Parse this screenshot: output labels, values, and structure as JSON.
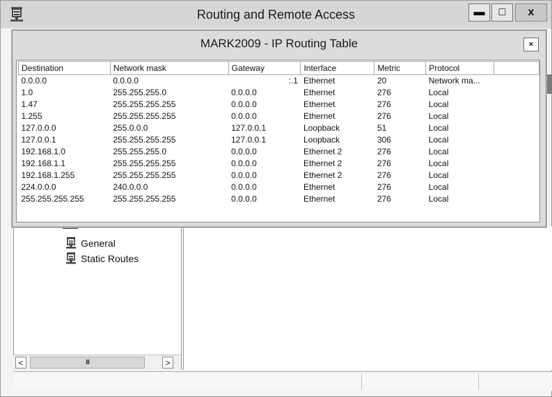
{
  "window": {
    "title": "Routing and Remote Access",
    "buttons": {
      "minimize": "▬",
      "maximize": "□",
      "close": "x"
    }
  },
  "dialog": {
    "title": "MARK2009 - IP Routing Table",
    "close_label": "×",
    "columns": [
      "Destination",
      "Network mask",
      "Gateway",
      "Interface",
      "Metric",
      "Protocol",
      ""
    ],
    "rows": [
      {
        "destination": "0.0.0.0",
        "mask": "0.0.0.0",
        "gateway": ":.1",
        "interface": "Ethernet",
        "metric": "20",
        "protocol": "Network ma..."
      },
      {
        "destination": "1.0",
        "mask": "255.255.255.0",
        "gateway": "0.0.0.0",
        "interface": "Ethernet",
        "metric": "276",
        "protocol": "Local"
      },
      {
        "destination": "1.47",
        "mask": "255.255.255.255",
        "gateway": "0.0.0.0",
        "interface": "Ethernet",
        "metric": "276",
        "protocol": "Local"
      },
      {
        "destination": "1.255",
        "mask": "255.255.255.255",
        "gateway": "0.0.0.0",
        "interface": "Ethernet",
        "metric": "276",
        "protocol": "Local"
      },
      {
        "destination": "127.0.0.0",
        "mask": "255.0.0.0",
        "gateway": "127.0.0.1",
        "interface": "Loopback",
        "metric": "51",
        "protocol": "Local"
      },
      {
        "destination": "127.0.0.1",
        "mask": "255.255.255.255",
        "gateway": "127.0.0.1",
        "interface": "Loopback",
        "metric": "306",
        "protocol": "Local"
      },
      {
        "destination": "192.168.1.0",
        "mask": "255.255.255.0",
        "gateway": "0.0.0.0",
        "interface": "Ethernet 2",
        "metric": "276",
        "protocol": "Local"
      },
      {
        "destination": "192.168.1.1",
        "mask": "255.255.255.255",
        "gateway": "0.0.0.0",
        "interface": "Ethernet 2",
        "metric": "276",
        "protocol": "Local"
      },
      {
        "destination": "192.168.1.255",
        "mask": "255.255.255.255",
        "gateway": "0.0.0.0",
        "interface": "Ethernet 2",
        "metric": "276",
        "protocol": "Local"
      },
      {
        "destination": "224.0.0.0",
        "mask": "240.0.0.0",
        "gateway": "0.0.0.0",
        "interface": "Ethernet",
        "metric": "276",
        "protocol": "Local"
      },
      {
        "destination": "255.255.255.255",
        "mask": "255.255.255.255",
        "gateway": "0.0.0.0",
        "interface": "Ethernet",
        "metric": "276",
        "protocol": "Local"
      }
    ]
  },
  "tree": {
    "items": [
      {
        "label": "General",
        "icon": "server-icon"
      },
      {
        "label": "Static Routes",
        "icon": "server-icon"
      }
    ]
  },
  "scrollbar": {
    "left_arrow": "<",
    "right_arrow": ">",
    "thumb_grip": "III"
  }
}
